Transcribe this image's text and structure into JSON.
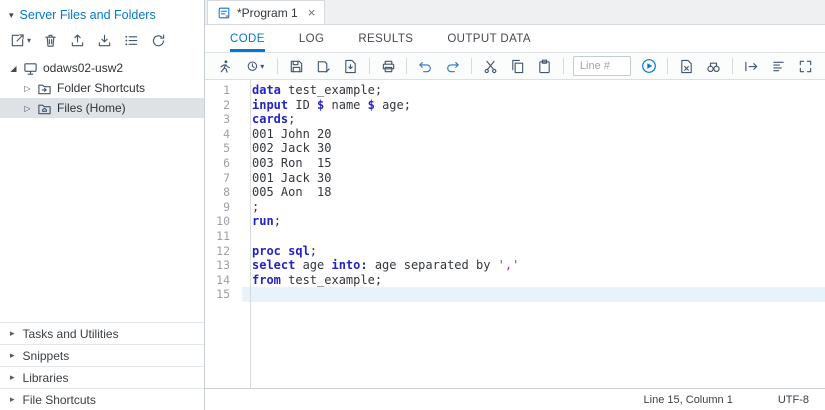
{
  "icons": {
    "collapse-caret": "▾",
    "expanded-node": "◢",
    "collapsed-node": "▷",
    "section-arrow": "▸",
    "close": "×",
    "dropdown-caret": "▾"
  },
  "colors": {
    "accent": "#0379cd",
    "keyword": "#2423c6",
    "string": "#9c36ae",
    "current_line": "#e7f2fb",
    "selected_tree_row": "#dde2e6"
  },
  "sidebar": {
    "header": "Server Files and Folders",
    "tree": {
      "server_label": "odaws02-usw2",
      "items": [
        {
          "label": "Folder Shortcuts"
        },
        {
          "label": "Files (Home)",
          "selected": true
        }
      ]
    },
    "sections": [
      "Tasks and Utilities",
      "Snippets",
      "Libraries",
      "File Shortcuts"
    ]
  },
  "main": {
    "program_tab": "*Program 1",
    "tabs": [
      "CODE",
      "LOG",
      "RESULTS",
      "OUTPUT DATA"
    ],
    "active_tab": "CODE",
    "toolbar": {
      "line_input_placeholder": "Line #"
    },
    "statusbar": {
      "position": "Line 15, Column 1",
      "encoding": "UTF-8"
    }
  },
  "editor": {
    "lines": [
      {
        "n": 1,
        "tokens": [
          {
            "t": "data",
            "c": "kw"
          },
          {
            "t": " test_example;",
            "c": "pl"
          }
        ]
      },
      {
        "n": 2,
        "tokens": [
          {
            "t": "input",
            "c": "kw"
          },
          {
            "t": " ID ",
            "c": "pl"
          },
          {
            "t": "$",
            "c": "kw"
          },
          {
            "t": " name ",
            "c": "pl"
          },
          {
            "t": "$",
            "c": "kw"
          },
          {
            "t": " age;",
            "c": "pl"
          }
        ]
      },
      {
        "n": 3,
        "tokens": [
          {
            "t": "cards",
            "c": "kw"
          },
          {
            "t": ";",
            "c": "pl"
          }
        ]
      },
      {
        "n": 4,
        "tokens": [
          {
            "t": "001 John 20",
            "c": "pl"
          }
        ]
      },
      {
        "n": 5,
        "tokens": [
          {
            "t": "002 Jack 30",
            "c": "pl"
          }
        ]
      },
      {
        "n": 6,
        "tokens": [
          {
            "t": "003 Ron  15",
            "c": "pl"
          }
        ]
      },
      {
        "n": 7,
        "tokens": [
          {
            "t": "001 Jack 30",
            "c": "pl"
          }
        ]
      },
      {
        "n": 8,
        "tokens": [
          {
            "t": "005 Aon  18",
            "c": "pl"
          }
        ]
      },
      {
        "n": 9,
        "tokens": [
          {
            "t": ";",
            "c": "pl"
          }
        ]
      },
      {
        "n": 10,
        "tokens": [
          {
            "t": "run",
            "c": "kw"
          },
          {
            "t": ";",
            "c": "pl"
          }
        ]
      },
      {
        "n": 11,
        "tokens": []
      },
      {
        "n": 12,
        "tokens": [
          {
            "t": "proc sql",
            "c": "kw"
          },
          {
            "t": ";",
            "c": "pl"
          }
        ]
      },
      {
        "n": 13,
        "tokens": [
          {
            "t": "select",
            "c": "kw"
          },
          {
            "t": " age ",
            "c": "pl"
          },
          {
            "t": "into:",
            "c": "kw"
          },
          {
            "t": " age separated by ",
            "c": "pl"
          },
          {
            "t": "','",
            "c": "str"
          }
        ]
      },
      {
        "n": 14,
        "tokens": [
          {
            "t": "from",
            "c": "kw"
          },
          {
            "t": " test_example;",
            "c": "pl"
          }
        ]
      },
      {
        "n": 15,
        "tokens": [],
        "current": true
      }
    ]
  }
}
